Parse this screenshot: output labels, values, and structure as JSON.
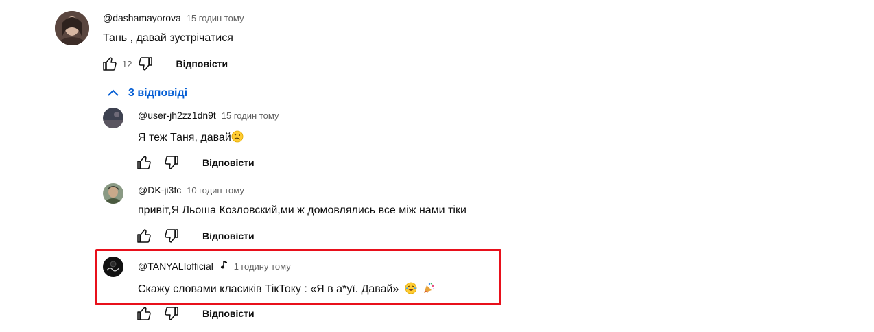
{
  "main_comment": {
    "author": "@dashamayorova",
    "time": "15 годин тому",
    "text": "Тань , давай зустрічатися",
    "likes": "12",
    "reply_label": "Відповісти"
  },
  "replies_toggle": {
    "label": "3 відповіді"
  },
  "replies": [
    {
      "author": "@user-jh2zz1dn9t",
      "time": "15 годин тому",
      "text": "Я теж Таня, давай",
      "reply_label": "Відповісти"
    },
    {
      "author": "@DK-ji3fc",
      "time": "10 годин тому",
      "text": "привіт,Я Льоша Козловский,ми ж домовлялись все між нами тіки",
      "reply_label": "Відповісти"
    },
    {
      "author": "@TANYALIofficial",
      "time": "1 годину тому",
      "text": "Скажу словами класиків ТікТоку : «Я в а*уї. Давай»",
      "reply_label": "Відповісти"
    }
  ],
  "colors": {
    "accent": "#065fd4",
    "highlight": "#e8101b",
    "meta": "#606060"
  }
}
